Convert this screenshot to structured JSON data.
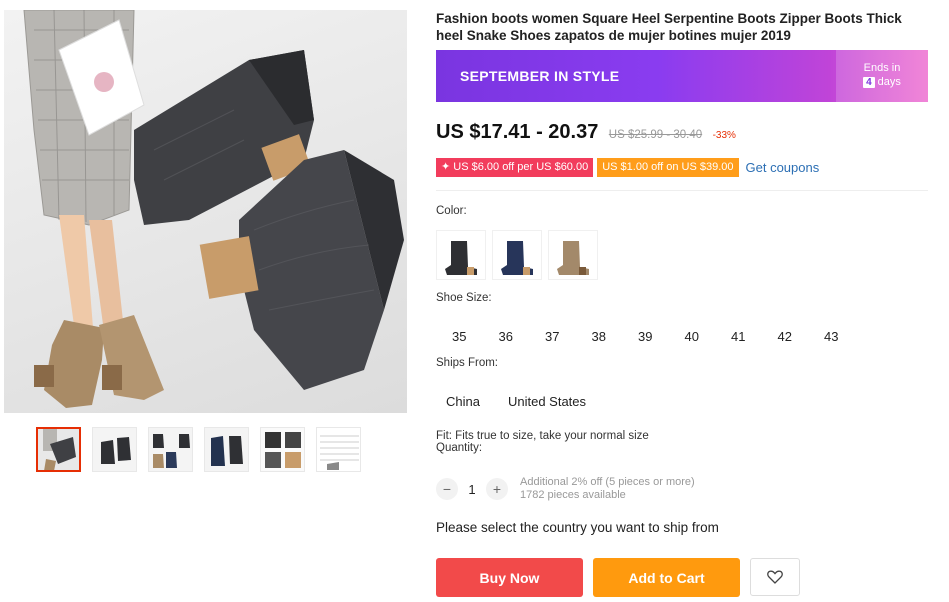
{
  "product": {
    "title": "Fashion boots women Square Heel Serpentine Boots Zipper Boots Thick heel Snake Shoes zapatos de mujer botines mujer 2019"
  },
  "banner": {
    "text": "SEPTEMBER IN STYLE",
    "ends_label": "Ends in",
    "days_number": "4",
    "days_label": "days"
  },
  "price": {
    "current": "US $17.41 - 20.37",
    "original": "US $25.99 - 30.40",
    "discount": "-33%"
  },
  "coupons": {
    "coupon1": "✦ US $6.00 off per US $60.00",
    "coupon2": "US $1.00 off on US $39.00",
    "link": "Get coupons"
  },
  "color": {
    "label": "Color:",
    "options": [
      "black-snake-boot",
      "blue-snake-boot",
      "khaki-snake-boot"
    ]
  },
  "size": {
    "label": "Shoe Size:",
    "options": [
      "35",
      "36",
      "37",
      "38",
      "39",
      "40",
      "41",
      "42",
      "43"
    ]
  },
  "shipping": {
    "label": "Ships From:",
    "options": [
      "China",
      "United States"
    ],
    "message": "Please select the country you want to ship from"
  },
  "fit": "Fit: Fits true to size, take your normal size",
  "quantity": {
    "label": "Quantity:",
    "value": "1",
    "note1": "Additional 2% off (5 pieces or more)",
    "note2": "1782 pieces available"
  },
  "actions": {
    "buy": "Buy Now",
    "cart": "Add to Cart"
  },
  "gallery": {
    "thumbnails": [
      "model-thumb",
      "black-pair-thumb",
      "colors-thumb",
      "blue-thumb",
      "detail-thumb",
      "size-chart-thumb"
    ]
  },
  "colors": {
    "price": "#111111",
    "discount": "#e62e04",
    "buy_button": "#f24a4a",
    "cart_button": "#ff9a0e",
    "coupons_link": "#2c6fb4"
  }
}
